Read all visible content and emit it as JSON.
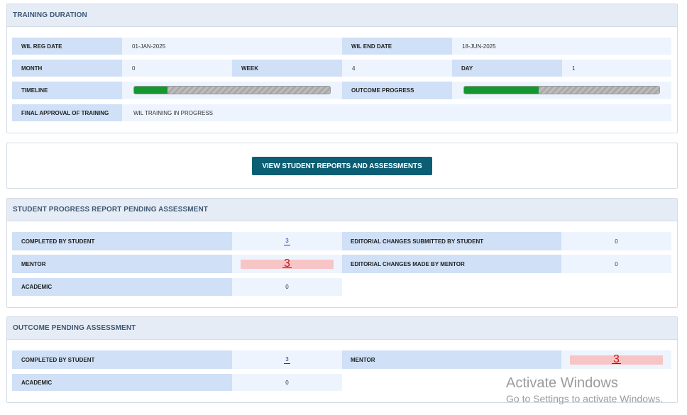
{
  "training_duration": {
    "title": "TRAINING DURATION",
    "wil_reg_date_label": "WIL REG DATE",
    "wil_reg_date_value": "01-JAN-2025",
    "wil_end_date_label": "WIL END DATE",
    "wil_end_date_value": "18-JUN-2025",
    "month_label": "MONTH",
    "month_value": "0",
    "week_label": "WEEK",
    "week_value": "4",
    "day_label": "DAY",
    "day_value": "1",
    "timeline_label": "TIMELINE",
    "timeline_progress": 0.17,
    "outcome_progress_label": "OUTCOME PROGRESS",
    "outcome_progress": 0.38,
    "final_approval_label": "FINAL APPROVAL OF TRAINING",
    "final_approval_value": "WIL TRAINING IN PROGRESS",
    "progress_color": "#12982e"
  },
  "actions": {
    "view_reports_label": "VIEW STUDENT REPORTS AND ASSESSMENTS",
    "button_color": "#0b5e73"
  },
  "progress_report": {
    "title": "STUDENT PROGRESS REPORT PENDING ASSESSMENT",
    "completed_by_student_label": "COMPLETED BY STUDENT",
    "completed_by_student_value": "3",
    "editorial_submitted_label": "EDITORIAL CHANGES SUBMITTED BY STUDENT",
    "editorial_submitted_value": "0",
    "mentor_label": "MENTOR",
    "mentor_value": "3",
    "editorial_mentor_label": "EDITORIAL CHANGES MADE BY MENTOR",
    "editorial_mentor_value": "0",
    "academic_label": "ACADEMIC",
    "academic_value": "0"
  },
  "outcome_assessment": {
    "title": "OUTCOME PENDING ASSESSMENT",
    "completed_by_student_label": "COMPLETED BY STUDENT",
    "completed_by_student_value": "3",
    "mentor_label": "MENTOR",
    "mentor_value": "3",
    "academic_label": "ACADEMIC",
    "academic_value": "0"
  },
  "watermark": {
    "line1": "Activate Windows",
    "line2": "Go to Settings to activate Windows."
  }
}
